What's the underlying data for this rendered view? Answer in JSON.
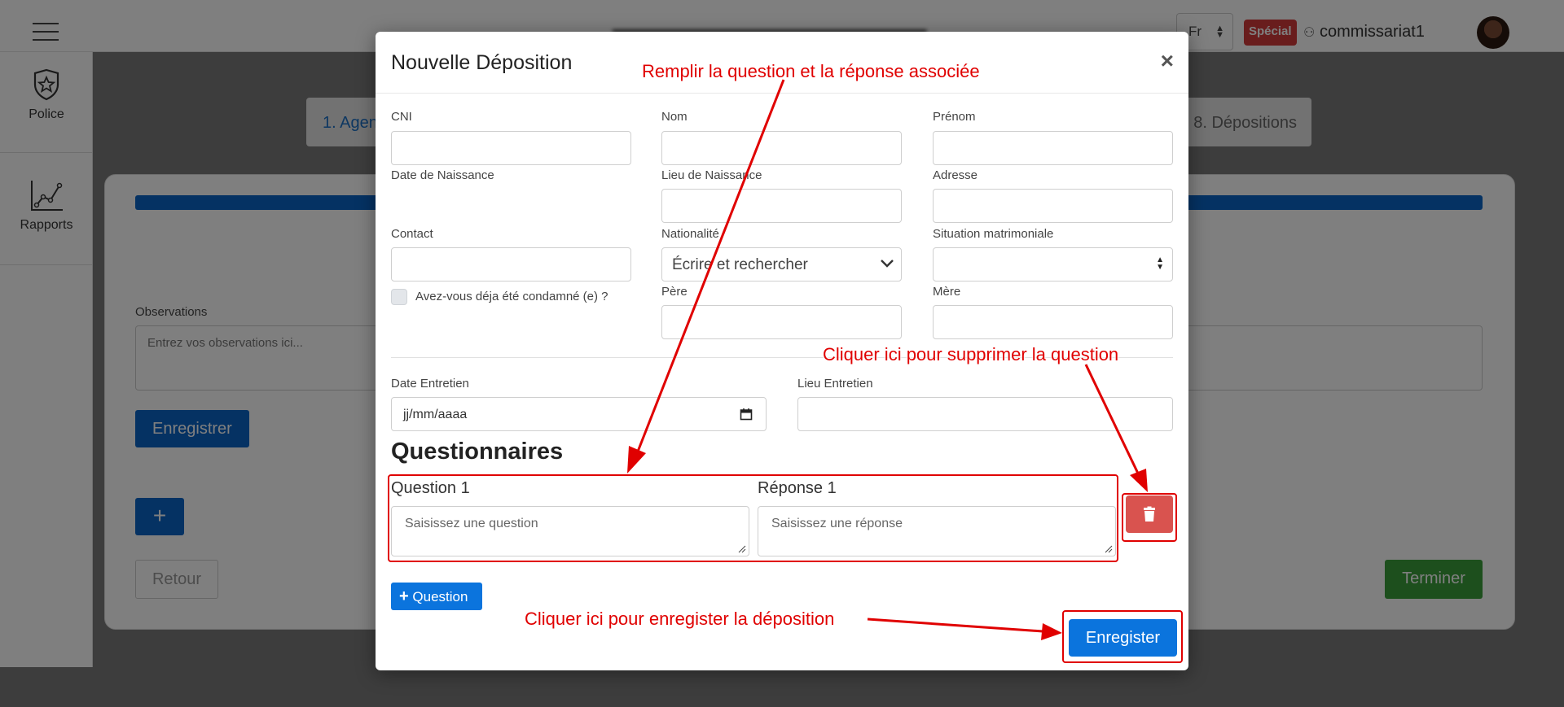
{
  "topbar": {
    "language": "Fr",
    "special_badge": "Spécial",
    "username": "commissariat1"
  },
  "sidebar": {
    "items": [
      {
        "label": "Police",
        "icon": "police-badge-icon"
      },
      {
        "label": "Rapports",
        "icon": "line-chart-icon"
      }
    ]
  },
  "background": {
    "step_first": "1. Agen",
    "step_last": "8. Dépositions",
    "observations_label": "Observations",
    "observations_placeholder": "Entrez vos observations ici...",
    "save_label": "Enregistrer",
    "add_label": "+",
    "back_label": "Retour",
    "finish_label": "Terminer"
  },
  "modal": {
    "title": "Nouvelle Déposition",
    "close": "×",
    "fields": {
      "cni": "CNI",
      "nom": "Nom",
      "prenom": "Prénom",
      "date_naissance": "Date de Naissance",
      "lieu_naissance": "Lieu de Naissance",
      "adresse": "Adresse",
      "contact": "Contact",
      "nationalite": "Nationalité",
      "nationalite_placeholder": "Écrire et rechercher",
      "situation": "Situation matrimoniale",
      "condamne": "Avez-vous déja été condamné (e) ?",
      "pere": "Père",
      "mere": "Mère",
      "date_entretien": "Date Entretien",
      "date_entretien_value": "jj/mm/aaaa",
      "lieu_entretien": "Lieu Entretien"
    },
    "questionnaires": {
      "heading": "Questionnaires",
      "question_label": "Question 1",
      "question_placeholder": "Saisissez une question",
      "answer_label": "Réponse 1",
      "answer_placeholder": "Saisissez une réponse",
      "add_question": "Question"
    },
    "save_label": "Enregister"
  },
  "annotations": {
    "fill_question": "Remplir la question et la réponse associée",
    "delete_question": "Cliquer ici pour supprimer la question",
    "save_deposition": "Cliquer ici pour enregister la déposition"
  },
  "colors": {
    "primary": "#0b74dd",
    "danger": "#d9534f",
    "annotation": "#e00000",
    "success": "#3b9e3b"
  }
}
